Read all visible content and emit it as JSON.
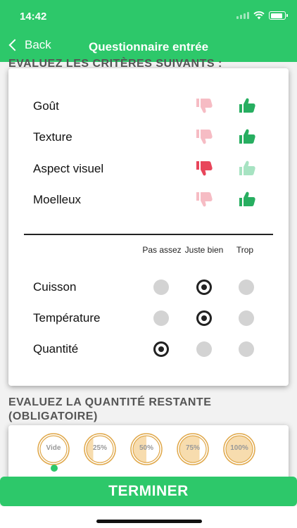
{
  "status_bar": {
    "time": "14:42"
  },
  "nav": {
    "back_label": "Back",
    "title": "Questionnaire entrée"
  },
  "partial_heading": "EVALUEZ LES CRITÈRES SUIVANTS :",
  "ratings": [
    {
      "label": "Goût",
      "down_state": "faded",
      "up_state": "active"
    },
    {
      "label": "Texture",
      "down_state": "faded",
      "up_state": "active"
    },
    {
      "label": "Aspect visuel",
      "down_state": "active",
      "up_state": "faded"
    },
    {
      "label": "Moelleux",
      "down_state": "faded",
      "up_state": "active"
    }
  ],
  "radio_columns": [
    "Pas assez",
    "Juste bien",
    "Trop"
  ],
  "radio_rows": [
    {
      "label": "Cuisson",
      "selected": 1
    },
    {
      "label": "Température",
      "selected": 1
    },
    {
      "label": "Quantité",
      "selected": 0
    }
  ],
  "quantity_section": {
    "title": "EVALUEZ LA QUANTITÉ RESTANTE (OBLIGATOIRE)",
    "options": [
      {
        "label": "Vide",
        "fill": 0
      },
      {
        "label": "25%",
        "fill": 0.25
      },
      {
        "label": "50%",
        "fill": 0.5
      },
      {
        "label": "75%",
        "fill": 0.75
      },
      {
        "label": "100%",
        "fill": 1
      }
    ],
    "selected": 0
  },
  "finish_button": "TERMINER",
  "colors": {
    "green": "#2dc86a",
    "thumb_up_active": "#27ae60",
    "thumb_up_faded": "#a7e3c2",
    "thumb_down_active": "#e8455a",
    "thumb_down_faded": "#f6bcc4",
    "quantity_ring": "#e0a84a",
    "quantity_fill": "#f7dcae"
  }
}
